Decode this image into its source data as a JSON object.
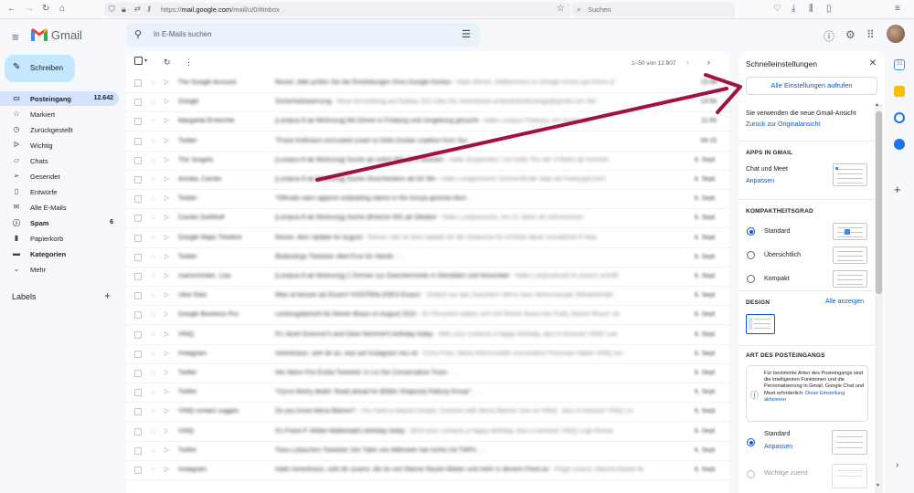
{
  "browser": {
    "url_prefix": "https://",
    "url_host": "mail.google.com",
    "url_path": "/mail/u/0/#inbox",
    "search_placeholder": "Suchen"
  },
  "header": {
    "app_name": "Gmail",
    "search_placeholder": "In E-Mails suchen"
  },
  "sidebar": {
    "compose_label": "Schreiben",
    "items": [
      {
        "label": "Posteingang",
        "count": "12.642",
        "icon": "inbox-icon"
      },
      {
        "label": "Markiert",
        "count": "",
        "icon": "star-icon"
      },
      {
        "label": "Zurückgestellt",
        "count": "",
        "icon": "clock-icon"
      },
      {
        "label": "Wichtig",
        "count": "",
        "icon": "important-icon"
      },
      {
        "label": "Chats",
        "count": "",
        "icon": "chat-icon"
      },
      {
        "label": "Gesendet",
        "count": "",
        "icon": "send-icon"
      },
      {
        "label": "Entwürfe",
        "count": "",
        "icon": "draft-icon"
      },
      {
        "label": "Alle E-Mails",
        "count": "",
        "icon": "mail-icon"
      },
      {
        "label": "Spam",
        "count": "6",
        "icon": "spam-icon"
      },
      {
        "label": "Papierkorb",
        "count": "",
        "icon": "trash-icon"
      },
      {
        "label": "Kategorien",
        "count": "",
        "icon": "label-icon"
      },
      {
        "label": "Mehr",
        "count": "",
        "icon": "chevron-down-icon"
      }
    ],
    "labels_heading": "Labels"
  },
  "maillist": {
    "pagination": "1–50 von 12.807",
    "rows": [
      {
        "sender": "The Google Account",
        "subject": "Reiner, bitte prüfen Sie die Einstellungen Ihres Google Kontos",
        "snippet": "- Hallo Reiner, Willkommen im Google Konto auf Ihrem G",
        "date": "15:08"
      },
      {
        "sender": "Google",
        "subject": "Sicherheitswarnung",
        "snippet": "- Neue Anmeldung auf Galaxy S21 Ultra 5G reinerbrave.anabolicbiotechlogy@gmail.com Wir",
        "date": "13:59"
      },
      {
        "sender": "Margarita Erntechte",
        "subject": "[Lumpus-9 ab Wohnung] Mit Dinner in Freiburg und Umgebung gesucht",
        "snippet": "- Hallo Lumpus Freiburg, Ich suche ab",
        "date": "11:05"
      },
      {
        "sender": "Twitter",
        "subject": "\"Frank Kollmann encrusted crown to Delhi Durbar coalition from Sur",
        "snippet": "- ...",
        "date": "09:15"
      },
      {
        "sender": "The Jungels",
        "subject": "[Lumpus-9 ab Wohnung] Suche ab sofort WG ab 4 Wochen",
        "snippet": "- Hallo Suspended / Ich hoffe Thu der 4 Wahn ab sommer",
        "date": "6. Sept."
      },
      {
        "sender": "Annika, Carolin",
        "subject": "[Lumpus-9 ab Wohnung] Suche Geschwistern ab Dir Wo",
        "snippet": "- Hallo Lumpenreiner Zimmer/Ende Sept ab Freiburg/Chem",
        "date": "6. Sept."
      },
      {
        "sender": "Twitter",
        "subject": "\"Officials warn against misleading claims in the Kenya general elect",
        "snippet": "...",
        "date": "6. Sept."
      },
      {
        "sender": "Carolin Gehlhoff",
        "subject": "[Lumpus-9 ab Wohnung] Suche ähnliche WG ab Oktober",
        "snippet": "- Hallo Lumpusreiner, Ich 21 Jahre alt und kommen",
        "date": "6. Sept."
      },
      {
        "sender": "Google Maps Timeline",
        "subject": "Reiner, dein Update für August",
        "snippet": "- Reiner, hier ist dein Update für die Zeitachse für erhöhte diese monatliche E-Mail",
        "date": "6. Sept."
      },
      {
        "sender": "Twitter",
        "subject": "Bedeutings Tweeted: #benTrue für Hands",
        "snippet": "- ...",
        "date": "6. Sept."
      },
      {
        "sender": "marrochmike, Lisa",
        "subject": "[Lumpus-9 ab Wohnung] 2 Zimmer zur Zwischenmiete in Wiesbden und November",
        "snippet": "- Hallo Lumpusbund Hi unsere schriftl",
        "date": "6. Sept."
      },
      {
        "sender": "Uber Eats",
        "subject": "Was ist besser als Essen? KOSTENLOSES Essen!",
        "snippet": "- Zeitlich nur das Zwischen! Wenn Dein Wohnmonate 2MedisGmbh",
        "date": "6. Sept."
      },
      {
        "sender": "Google Business Pro",
        "subject": "Leistungsbericht für Reiner Braun im August 2022",
        "snippet": "- Ihr Personen haben sich mit Reiner Braun bei Profil, Reiner Braun\" an",
        "date": "6. Sept."
      },
      {
        "sender": "VINQ",
        "subject": "It's Janet Grannon's and Dave Nemmel's birthday today",
        "snippet": "- With your contacts a happy birthday, also in browser VINQ Law",
        "date": "6. Sept."
      },
      {
        "sender": "Instagram",
        "subject": "reinerbraun, sieh dir an, was auf Instagram neu ist",
        "snippet": "- Chris Freis, Marie Wehrschaffe und weitere Personen haben VINQ Ins",
        "date": "6. Sept."
      },
      {
        "sender": "Twitter",
        "subject": "Her Mann Fire Emba Tweeted: In Lin the Conservative Trues",
        "snippet": "- ...",
        "date": "6. Sept."
      },
      {
        "sender": "Twitter",
        "subject": "\"Cyrus Mistry death: Road ahead for $50bn Shapoorji Pallonji Group\"",
        "snippet": "- ...",
        "date": "6. Sept."
      },
      {
        "sender": "VINQ contact sugges",
        "subject": "Do you know Alena Blamer?",
        "snippet": "- You have a shared contact. Connect with Alena Blamer now on VINQ - also in browser VINQ Lin",
        "date": "6. Sept."
      },
      {
        "sender": "VINQ",
        "subject": "It's Frank P. Müller-Maltewald's birthday today",
        "snippet": "- Wish your contacts a happy birthday, also in browser VINQ Logo Reiner",
        "date": "6. Sept."
      },
      {
        "sender": "Twitter",
        "subject": "Tiina Lukaschev Tweeted: Der Täter von Mittmeier hat nichts mit TWPs",
        "snippet": "- ...",
        "date": "6. Sept."
      },
      {
        "sender": "Instagram",
        "subject": "Hallo reinerbraun, sieh dir unsere, die du von Marine Rauke-Weber und mehr in deinem Feed an",
        "snippet": "- Folge unsere, Marina Rauke-W",
        "date": "6. Sept."
      }
    ]
  },
  "quick_settings": {
    "title": "Schnelleinstellungen",
    "all_settings_button": "Alle Einstellungen aufrufen",
    "new_view_text": "Sie verwenden die neue Gmail-Ansicht",
    "original_view_link": "Zurück zur Originalansicht",
    "apps_heading": "APPS IN GMAIL",
    "chat_meet_label": "Chat und Meet",
    "chat_meet_link": "Anpassen",
    "density_heading": "KOMPAKTHEITSGRAD",
    "density_options": [
      "Standard",
      "Übersichtlich",
      "Kompakt"
    ],
    "density_selected": "Standard",
    "design_heading": "DESIGN",
    "design_link": "Alle anzeigen",
    "inbox_type_heading": "ART DES POSTEINGANGS",
    "inbox_info_text": "Für bestimmte Arten des Posteingangs sind die intelligenten Funktionen und die Personalisierung in Gmail, Google Chat und Meet erforderlich.",
    "inbox_info_link": "Diese Einstellung aktivieren",
    "inbox_options": [
      "Standard",
      "Wichtige zuerst"
    ],
    "inbox_standard_link": "Anpassen",
    "inbox_selected": "Standard"
  },
  "colors": {
    "accent": "#0b57d0",
    "compose_bg": "#c2e7ff",
    "active_nav_bg": "#d3e3fd",
    "annotation_arrow": "#a3123e"
  }
}
